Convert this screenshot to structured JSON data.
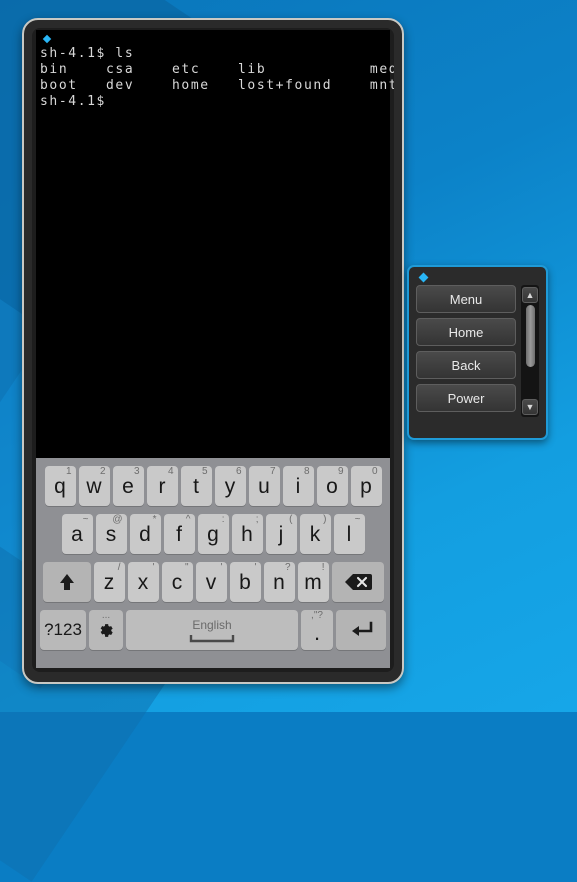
{
  "terminal": {
    "lines": [
      "sh-4.1$ ls",
      "bin    csa    etc    lib           media",
      "boot   dev    home   lost+found    mnt",
      "sh-4.1$"
    ],
    "dot_color": "#29b6f6",
    "bg_color": "#000000",
    "fg_color": "#d8d8d8"
  },
  "keyboard": {
    "row1": [
      {
        "label": "q",
        "sup": "1"
      },
      {
        "label": "w",
        "sup": "2"
      },
      {
        "label": "e",
        "sup": "3"
      },
      {
        "label": "r",
        "sup": "4"
      },
      {
        "label": "t",
        "sup": "5"
      },
      {
        "label": "y",
        "sup": "6"
      },
      {
        "label": "u",
        "sup": "7"
      },
      {
        "label": "i",
        "sup": "8"
      },
      {
        "label": "o",
        "sup": "9"
      },
      {
        "label": "p",
        "sup": "0"
      }
    ],
    "row2": [
      {
        "label": "a",
        "sup": "~"
      },
      {
        "label": "s",
        "sup": "@"
      },
      {
        "label": "d",
        "sup": "*"
      },
      {
        "label": "f",
        "sup": "^"
      },
      {
        "label": "g",
        "sup": ":"
      },
      {
        "label": "h",
        "sup": ";"
      },
      {
        "label": "j",
        "sup": "("
      },
      {
        "label": "k",
        "sup": ")"
      },
      {
        "label": "l",
        "sup": "~"
      }
    ],
    "row3": [
      {
        "label": "z",
        "sup": "/"
      },
      {
        "label": "x",
        "sup": "'"
      },
      {
        "label": "c",
        "sup": "\""
      },
      {
        "label": "v",
        "sup": "'"
      },
      {
        "label": "b",
        "sup": "'"
      },
      {
        "label": "n",
        "sup": "?"
      },
      {
        "label": "m",
        "sup": "!"
      }
    ],
    "shift_icon": "shift-arrow-icon",
    "backspace_icon": "backspace-icon",
    "symbols_label": "?123",
    "gear_icon": "gear-icon",
    "gear_sup": "...",
    "space_label": "English",
    "period_label": ".",
    "period_sup": ",\"?",
    "enter_icon": "enter-icon",
    "bg_color": "#8f9094",
    "key_color": "#c9c9c9"
  },
  "control_panel": {
    "buttons": [
      {
        "label": "Menu"
      },
      {
        "label": "Home"
      },
      {
        "label": "Back"
      },
      {
        "label": "Power"
      }
    ],
    "scroll_up_icon": "chevron-up-icon",
    "scroll_down_icon": "chevron-down-icon",
    "dot_color": "#29b6f6",
    "border_color": "#1f9bd8"
  }
}
